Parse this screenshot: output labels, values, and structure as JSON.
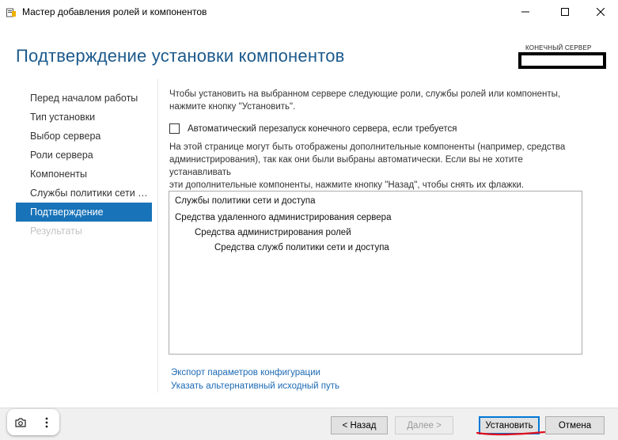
{
  "window": {
    "title": "Мастер добавления ролей и компонентов"
  },
  "header": {
    "page_title": "Подтверждение установки компонентов",
    "destination_label": "КОНЕЧНЫЙ СЕРВЕР",
    "destination_value_redacted": true
  },
  "nav": {
    "items": [
      {
        "label": "Перед началом работы",
        "state": "normal"
      },
      {
        "label": "Тип установки",
        "state": "normal"
      },
      {
        "label": "Выбор сервера",
        "state": "normal"
      },
      {
        "label": "Роли сервера",
        "state": "normal"
      },
      {
        "label": "Компоненты",
        "state": "normal"
      },
      {
        "label": "Службы политики сети и доступа",
        "state": "normal"
      },
      {
        "label": "Подтверждение",
        "state": "active"
      },
      {
        "label": "Результаты",
        "state": "disabled"
      }
    ]
  },
  "main": {
    "intro_line1": "Чтобы установить на выбранном сервере следующие роли, службы ролей или компоненты,",
    "intro_line2": "нажмите кнопку \"Установить\".",
    "restart_checkbox": {
      "label": "Автоматический перезапуск конечного сервера, если требуется",
      "checked": false
    },
    "note_line1": "На этой странице могут быть отображены дополнительные компоненты (например, средства",
    "note_line2": "администрирования), так как они были выбраны автоматически. Если вы не хотите устанавливать",
    "note_line3": "эти дополнительные компоненты, нажмите кнопку \"Назад\", чтобы снять их флажки.",
    "features": [
      {
        "label": "Службы политики сети и доступа",
        "level": 0
      },
      {
        "label": "Средства удаленного администрирования сервера",
        "level": 0
      },
      {
        "label": "Средства администрирования ролей",
        "level": 1
      },
      {
        "label": "Средства служб политики сети и доступа",
        "level": 2
      }
    ],
    "export_link": "Экспорт параметров конфигурации",
    "alt_source_link": "Указать альтернативный исходный путь"
  },
  "footer": {
    "back": "< Назад",
    "next": "Далее >",
    "install": "Установить",
    "cancel": "Отмена"
  },
  "overlay_toolbar": {
    "icons": [
      "camera-icon",
      "more-vertical-icon"
    ]
  },
  "colors": {
    "title_blue": "#1c5a8c",
    "nav_active_bg": "#1873b8",
    "link_blue": "#1d6ab4",
    "annotation_red": "#e0101e"
  }
}
